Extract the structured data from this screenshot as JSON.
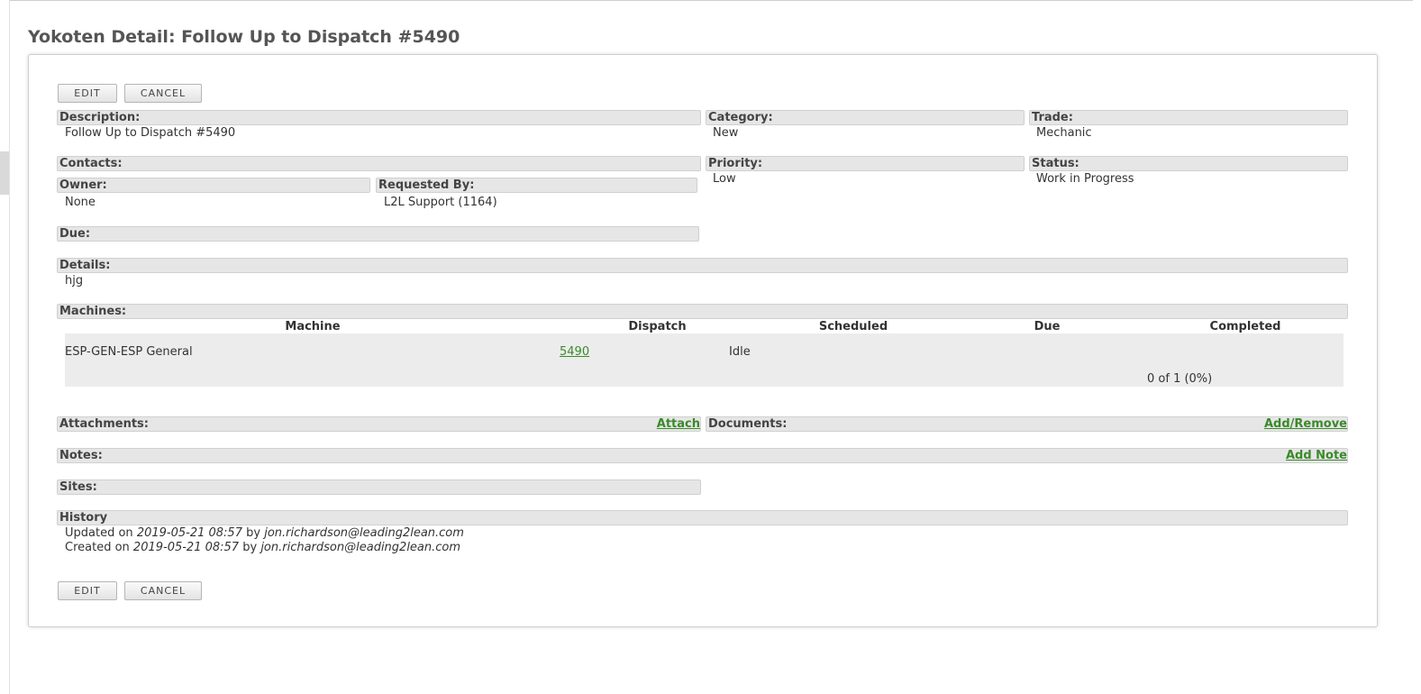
{
  "page": {
    "title": "Yokoten Detail: Follow Up to Dispatch #5490"
  },
  "buttons": {
    "edit": "EDIT",
    "cancel": "CANCEL"
  },
  "fields": {
    "description": {
      "label": "Description:",
      "value": "Follow Up to Dispatch #5490"
    },
    "category": {
      "label": "Category:",
      "value": "New"
    },
    "trade": {
      "label": "Trade:",
      "value": "Mechanic"
    },
    "contacts": {
      "label": "Contacts:"
    },
    "priority": {
      "label": "Priority:",
      "value": "Low"
    },
    "status": {
      "label": "Status:",
      "value": "Work in Progress"
    },
    "owner": {
      "label": "Owner:",
      "value": "None"
    },
    "requested_by": {
      "label": "Requested By:",
      "value": "L2L Support (1164)"
    },
    "due": {
      "label": "Due:"
    },
    "details": {
      "label": "Details:",
      "value": "hjg"
    }
  },
  "machines": {
    "label": "Machines:",
    "columns": [
      "Machine",
      "Dispatch",
      "Scheduled",
      "Due",
      "Completed"
    ],
    "rows": [
      {
        "machine": "ESP-GEN-ESP General",
        "dispatch": "5490",
        "scheduled": "Idle",
        "due": "",
        "completed": "0 of 1 (0%)"
      }
    ]
  },
  "attachments": {
    "label": "Attachments:",
    "action": "Attach"
  },
  "documents": {
    "label": "Documents:",
    "action": "Add/Remove"
  },
  "notes": {
    "label": "Notes:",
    "action": "Add Note"
  },
  "sites": {
    "label": "Sites:"
  },
  "history": {
    "label": "History",
    "entries": [
      {
        "action": "Updated on",
        "timestamp": "2019-05-21 08:57",
        "by": "by",
        "user": "jon.richardson@leading2lean.com"
      },
      {
        "action": "Created on",
        "timestamp": "2019-05-21 08:57",
        "by": "by",
        "user": "jon.richardson@leading2lean.com"
      }
    ]
  }
}
